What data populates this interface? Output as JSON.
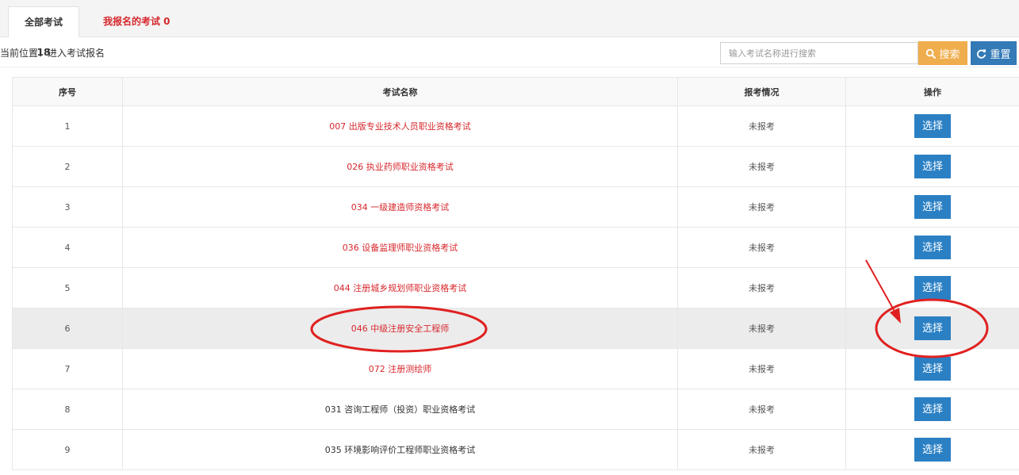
{
  "tabs": {
    "all_label": "全部考试 18",
    "mine_label": "我报名的考试 0"
  },
  "location_text": "当前位置：进入考试报名",
  "search": {
    "placeholder": "输入考试名称进行搜索",
    "value": "",
    "search_label": "搜索",
    "reset_label": "重置"
  },
  "table": {
    "headers": {
      "no": "序号",
      "name": "考试名称",
      "status": "报考情况",
      "action": "操作"
    },
    "rows": [
      {
        "no": "1",
        "name": "007 出版专业技术人员职业资格考试",
        "status": "未报考",
        "action": "选择"
      },
      {
        "no": "2",
        "name": "026 执业药师职业资格考试",
        "status": "未报考",
        "action": "选择"
      },
      {
        "no": "3",
        "name": "034 一级建造师资格考试",
        "status": "未报考",
        "action": "选择"
      },
      {
        "no": "4",
        "name": "036 设备监理师职业资格考试",
        "status": "未报考",
        "action": "选择"
      },
      {
        "no": "5",
        "name": "044 注册城乡规划师职业资格考试",
        "status": "未报考",
        "action": "选择"
      },
      {
        "no": "6",
        "name": "046 中级注册安全工程师",
        "status": "未报考",
        "action": "选择"
      },
      {
        "no": "7",
        "name": "072 注册测绘师",
        "status": "未报考",
        "action": "选择"
      },
      {
        "no": "8",
        "name": "031 咨询工程师（投资）职业资格考试",
        "status": "未报考",
        "action": "选择"
      },
      {
        "no": "9",
        "name": "035 环境影响评价工程师职业资格考试",
        "status": "未报考",
        "action": "选择"
      }
    ]
  },
  "colors": {
    "link_red": "#d7282d",
    "search_orange": "#f0ad4e",
    "reset_blue": "#337ab7",
    "select_blue": "#2b80c4",
    "annotation_red": "#e02020"
  }
}
